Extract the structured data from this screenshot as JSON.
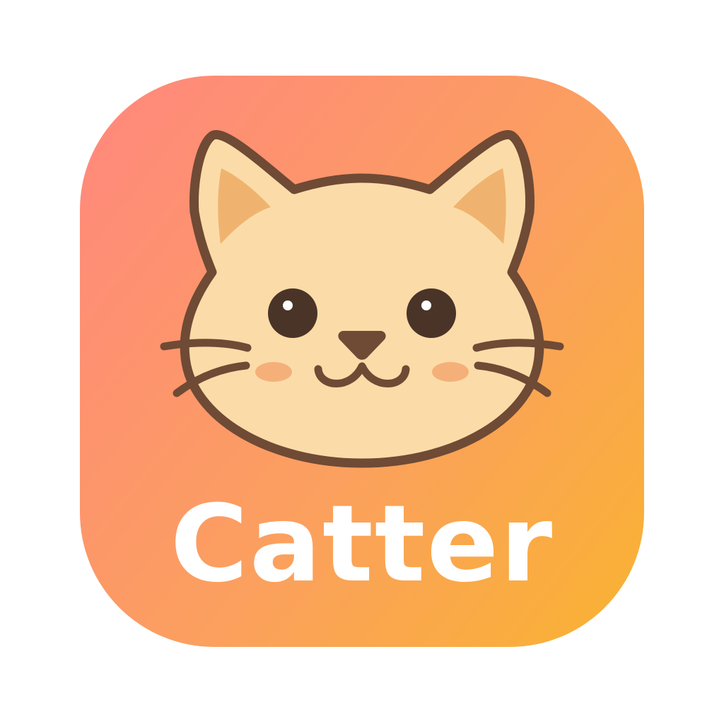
{
  "app": {
    "name": "Catter"
  },
  "icon": {
    "glyph": "cat-face-icon"
  },
  "colors": {
    "gradient_start": "#FF8A7A",
    "gradient_mid": "#FBA05E",
    "gradient_end": "#F9B233",
    "cat_fur": "#FBDCA8",
    "cat_outline": "#6F4A35",
    "inner_ear": "#F0B36F",
    "cheek": "#F5B07A",
    "nose": "#6F4A35",
    "eye": "#4A3428",
    "text": "#FFFFFF"
  }
}
